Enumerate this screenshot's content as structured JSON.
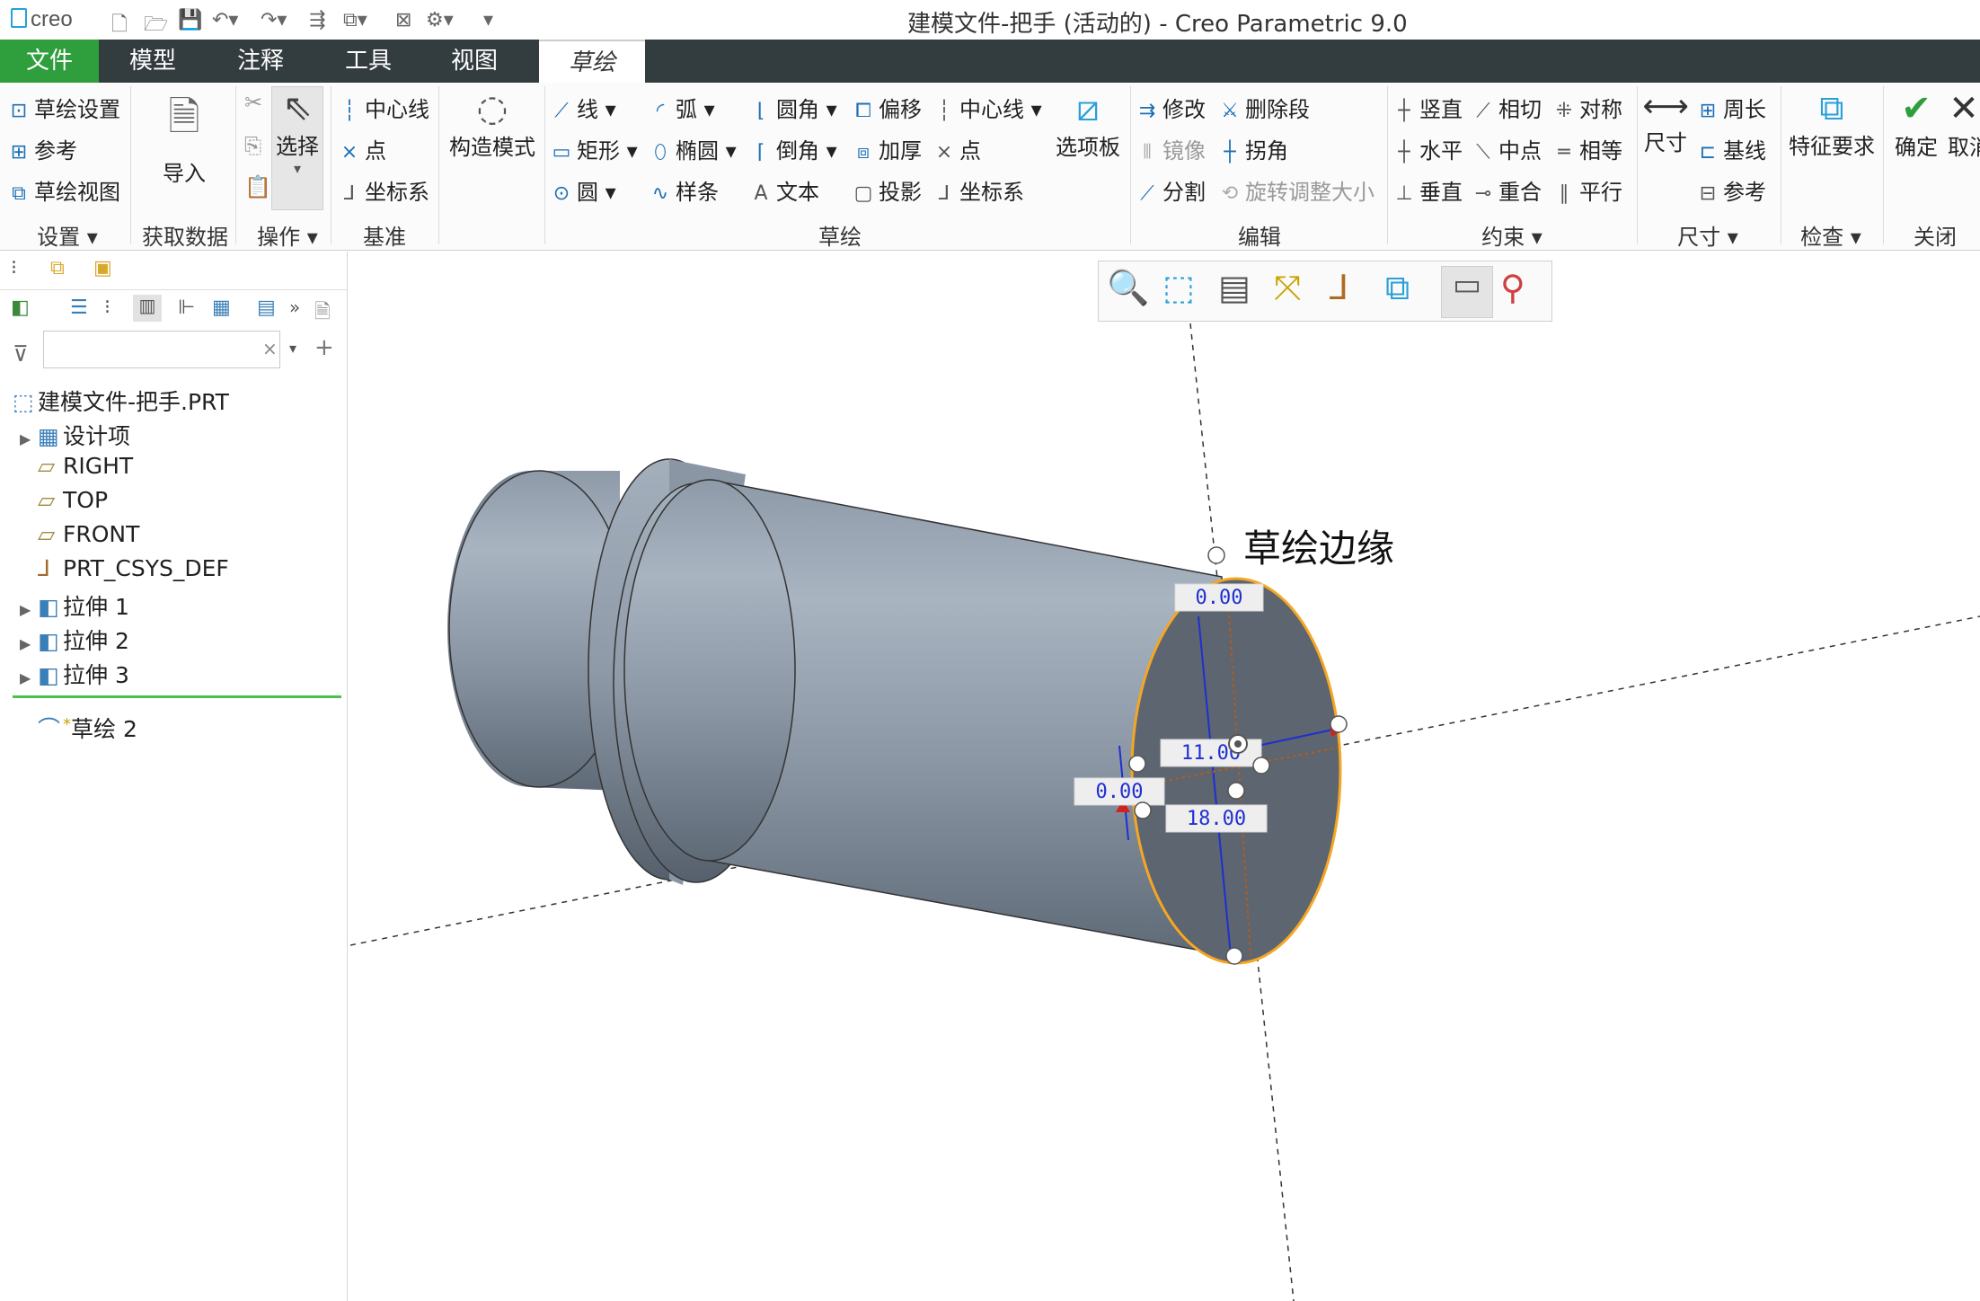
{
  "app": {
    "logo": "creo",
    "window_title": "建模文件-把手 (活动的) - Creo Parametric 9.0"
  },
  "tabs": [
    {
      "label": "文件"
    },
    {
      "label": "模型"
    },
    {
      "label": "注释"
    },
    {
      "label": "工具"
    },
    {
      "label": "视图"
    },
    {
      "label": "草绘"
    }
  ],
  "ribbon": {
    "setup": {
      "items": [
        "草绘设置",
        "参考",
        "草绘视图"
      ],
      "group": "设置"
    },
    "get_data": {
      "import": "导入",
      "group": "获取数据"
    },
    "operations": {
      "select": "选择",
      "group": "操作"
    },
    "datum": {
      "items": [
        "中心线",
        "点",
        "坐标系"
      ],
      "group": "基准"
    },
    "construction": {
      "label": "构造模式"
    },
    "sketching": {
      "col1": [
        "线",
        "矩形",
        "圆"
      ],
      "col2": [
        "弧",
        "椭圆",
        "样条"
      ],
      "col3": [
        "圆角",
        "倒角",
        "文本"
      ],
      "col4": [
        "偏移",
        "加厚",
        "投影"
      ],
      "col5": [
        "中心线",
        "点",
        "坐标系"
      ],
      "palette": "选项板",
      "group": "草绘"
    },
    "editing": {
      "items": [
        "修改",
        "删除段",
        "镜像",
        "拐角",
        "分割",
        "旋转调整大小"
      ],
      "group": "编辑"
    },
    "constrain": {
      "items": [
        "竖直",
        "相切",
        "对称",
        "水平",
        "中点",
        "相等",
        "垂直",
        "重合",
        "平行"
      ],
      "group": "约束"
    },
    "dimension": {
      "dimension": "尺寸",
      "items": [
        "周长",
        "基线",
        "参考"
      ],
      "group": "尺寸"
    },
    "inspect": {
      "label": "特征要求",
      "group": "检查"
    },
    "close": {
      "ok": "确定",
      "cancel": "取消",
      "group": "关闭"
    }
  },
  "model_tree": {
    "filter_placeholder": "",
    "root": "建模文件-把手.PRT",
    "items": [
      {
        "label": "设计项",
        "expandable": true
      },
      {
        "label": "RIGHT",
        "expandable": false
      },
      {
        "label": "TOP",
        "expandable": false
      },
      {
        "label": "FRONT",
        "expandable": false
      },
      {
        "label": "PRT_CSYS_DEF",
        "expandable": false
      },
      {
        "label": "拉伸 1",
        "expandable": true
      },
      {
        "label": "拉伸 2",
        "expandable": true
      },
      {
        "label": "拉伸 3",
        "expandable": true
      }
    ],
    "active_feature": "草绘 2",
    "active_marker": "*"
  },
  "canvas": {
    "annotation": "草绘边缘",
    "dimensions": [
      "0.00",
      "11.00",
      "0.00",
      "18.00"
    ]
  },
  "colors": {
    "file_tab": "#2f9e3c",
    "tab_bar": "#333c3f",
    "ok_check": "#2f9e3c",
    "sketch_edge": "#f5a623",
    "dimension_blue": "#1f2fd0",
    "constraint_red": "#d0201f",
    "part_gray": "#9aa6b4"
  }
}
